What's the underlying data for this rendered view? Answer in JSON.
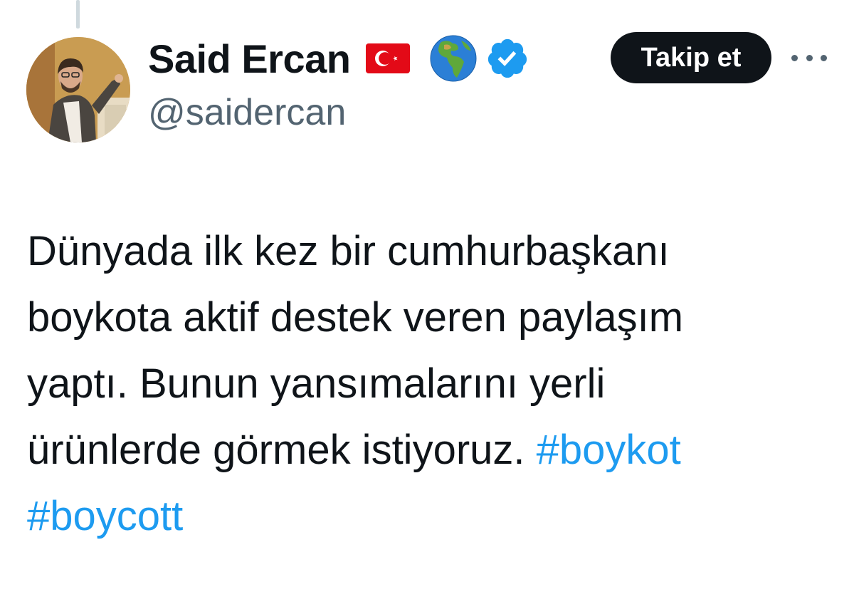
{
  "author": {
    "display_name": "Said Ercan",
    "handle": "@saidercan",
    "name_emojis": [
      "turkey-flag",
      "globe-europe-africa"
    ],
    "verified": true,
    "verified_color": "#1d9bf0"
  },
  "actions": {
    "follow_label": "Takip et",
    "more_icon": "ellipsis-icon"
  },
  "tweet": {
    "line1": "Dünyada ilk kez bir cumhurbaşkanı",
    "line2": "boykota aktif destek veren paylaşım",
    "line3": "yaptı. Bunun yansımalarını yerli",
    "line4_text": "ürünlerde görmek istiyoruz. ",
    "hashtags": [
      "#boykot",
      "#boycott"
    ]
  },
  "colors": {
    "text": "#0f1419",
    "secondary": "#536471",
    "link": "#1d9bf0",
    "button_bg": "#0f1419"
  }
}
